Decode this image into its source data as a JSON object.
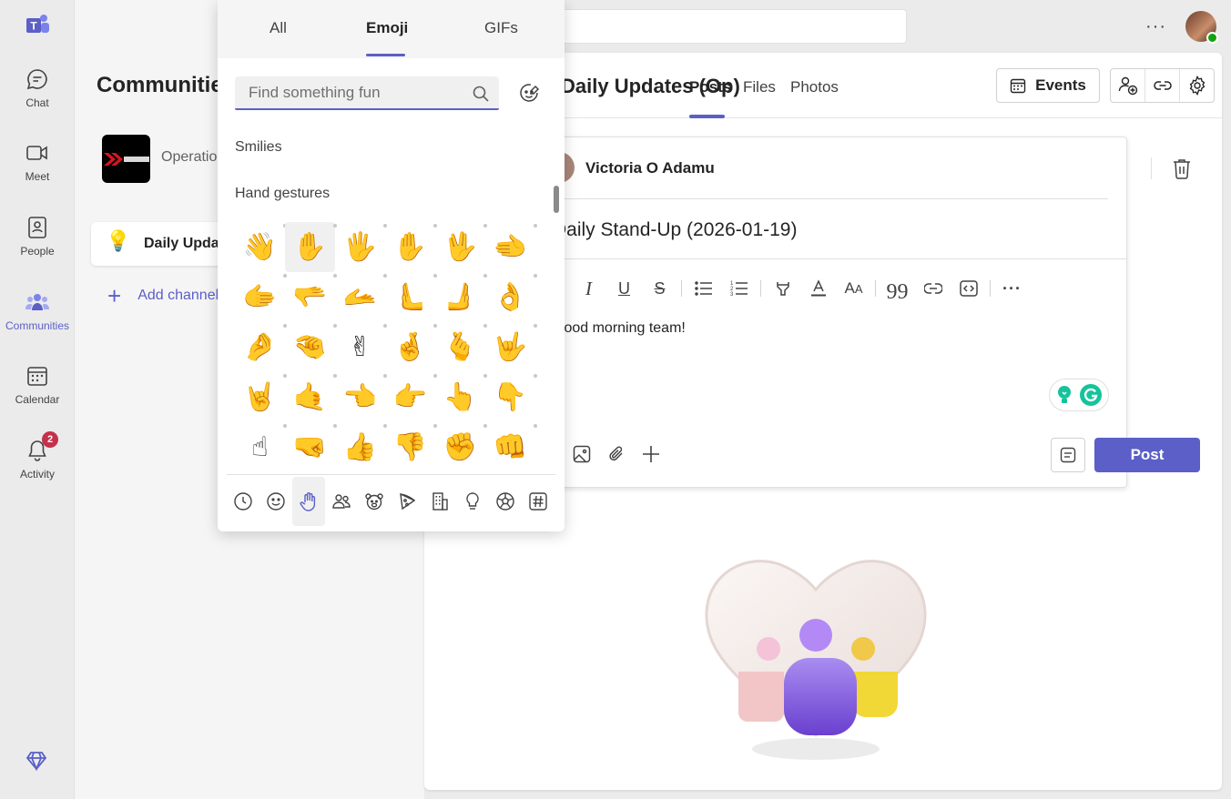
{
  "rail": {
    "items": [
      {
        "label": "Chat"
      },
      {
        "label": "Meet"
      },
      {
        "label": "People"
      },
      {
        "label": "Communities"
      },
      {
        "label": "Calendar"
      },
      {
        "label": "Activity",
        "badge": "2"
      }
    ]
  },
  "communities": {
    "title": "Communities",
    "community_name": "Operations",
    "active_channel": "Daily Updates",
    "add_channel": "Add channel"
  },
  "channel": {
    "title": "Daily Updates (Op)",
    "tabs": [
      {
        "label": "Posts"
      },
      {
        "label": "Files"
      },
      {
        "label": "Photos"
      }
    ],
    "events_label": "Events"
  },
  "compose": {
    "author": "Victoria O Adamu",
    "subject": "Daily Stand-Up (2026-01-19)",
    "body": "Good morning team!",
    "post_label": "Post"
  },
  "picker": {
    "tabs": [
      {
        "label": "All"
      },
      {
        "label": "Emoji"
      },
      {
        "label": "GIFs"
      }
    ],
    "search_placeholder": "Find something fun",
    "sections": [
      "Smilies",
      "Hand gestures"
    ],
    "emojis": [
      "👋",
      "✋",
      "🖐",
      "✋",
      "🖖",
      "🫲",
      "🫱",
      "🫳",
      "🫴",
      "🫷",
      "🫸",
      "👌",
      "🤌",
      "🤏",
      "✌",
      "🤞",
      "🫰",
      "🤟",
      "🤘",
      "🤙",
      "👈",
      "👉",
      "👆",
      "👇",
      "☝",
      "🤜",
      "👍",
      "👎",
      "✊",
      "👊"
    ]
  },
  "colors": {
    "accent": "#5b5fc7",
    "badge": "#c4314b",
    "online": "#13a10e"
  }
}
